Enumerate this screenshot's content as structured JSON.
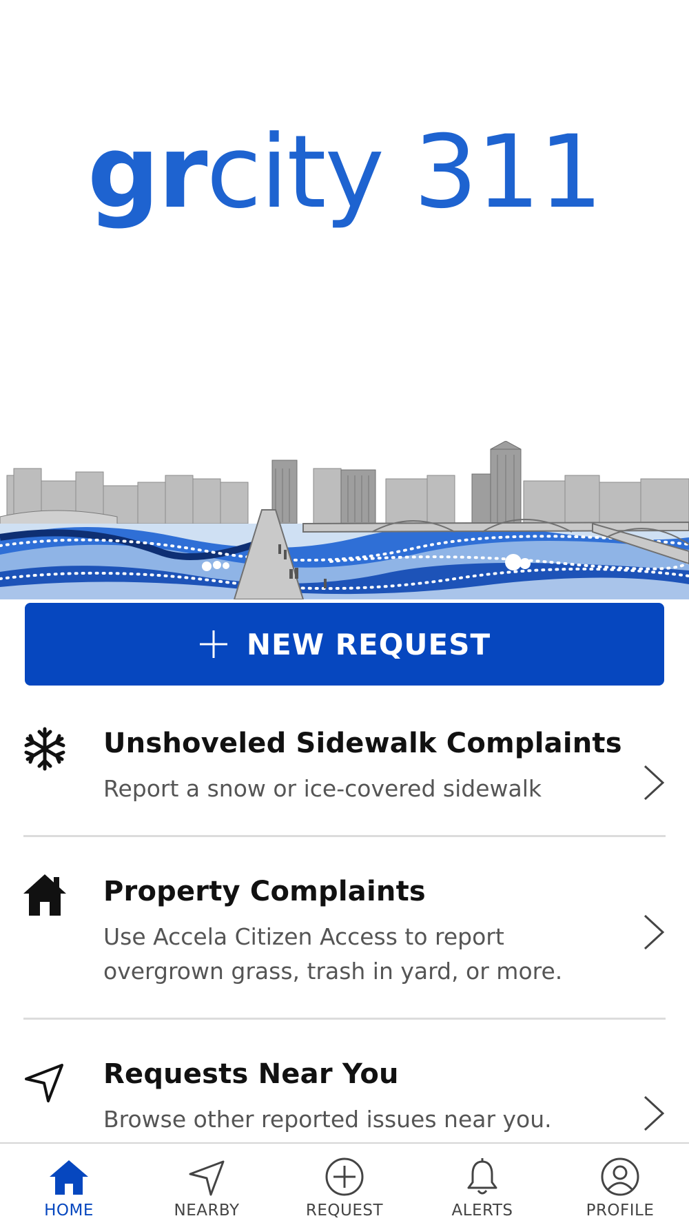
{
  "logo": {
    "bold_part": "gr",
    "regular_part": "city 311"
  },
  "new_request": {
    "label": "NEW REQUEST",
    "icon": "plus-icon"
  },
  "list": [
    {
      "icon": "snowflake-icon",
      "title": "Unshoveled Sidewalk Complaints",
      "description": "Report a snow or ice-covered sidewalk"
    },
    {
      "icon": "house-icon",
      "title": "Property Complaints",
      "description": "Use Accela Citizen Access to report overgrown grass, trash in yard, or more."
    },
    {
      "icon": "navigation-arrow-icon",
      "title": "Requests Near You",
      "description": "Browse other reported issues near you."
    }
  ],
  "tabs": [
    {
      "label": "HOME",
      "icon": "home-icon",
      "active": true
    },
    {
      "label": "NEARBY",
      "icon": "navigation-arrow-icon",
      "active": false
    },
    {
      "label": "REQUEST",
      "icon": "plus-circle-icon",
      "active": false
    },
    {
      "label": "ALERTS",
      "icon": "bell-icon",
      "active": false
    },
    {
      "label": "PROFILE",
      "icon": "user-circle-icon",
      "active": false
    }
  ],
  "colors": {
    "brand_blue": "#0647BF",
    "logo_blue": "#1E63D0",
    "text_dark": "#111111",
    "text_muted": "#555555",
    "divider": "#dcdcdc"
  }
}
